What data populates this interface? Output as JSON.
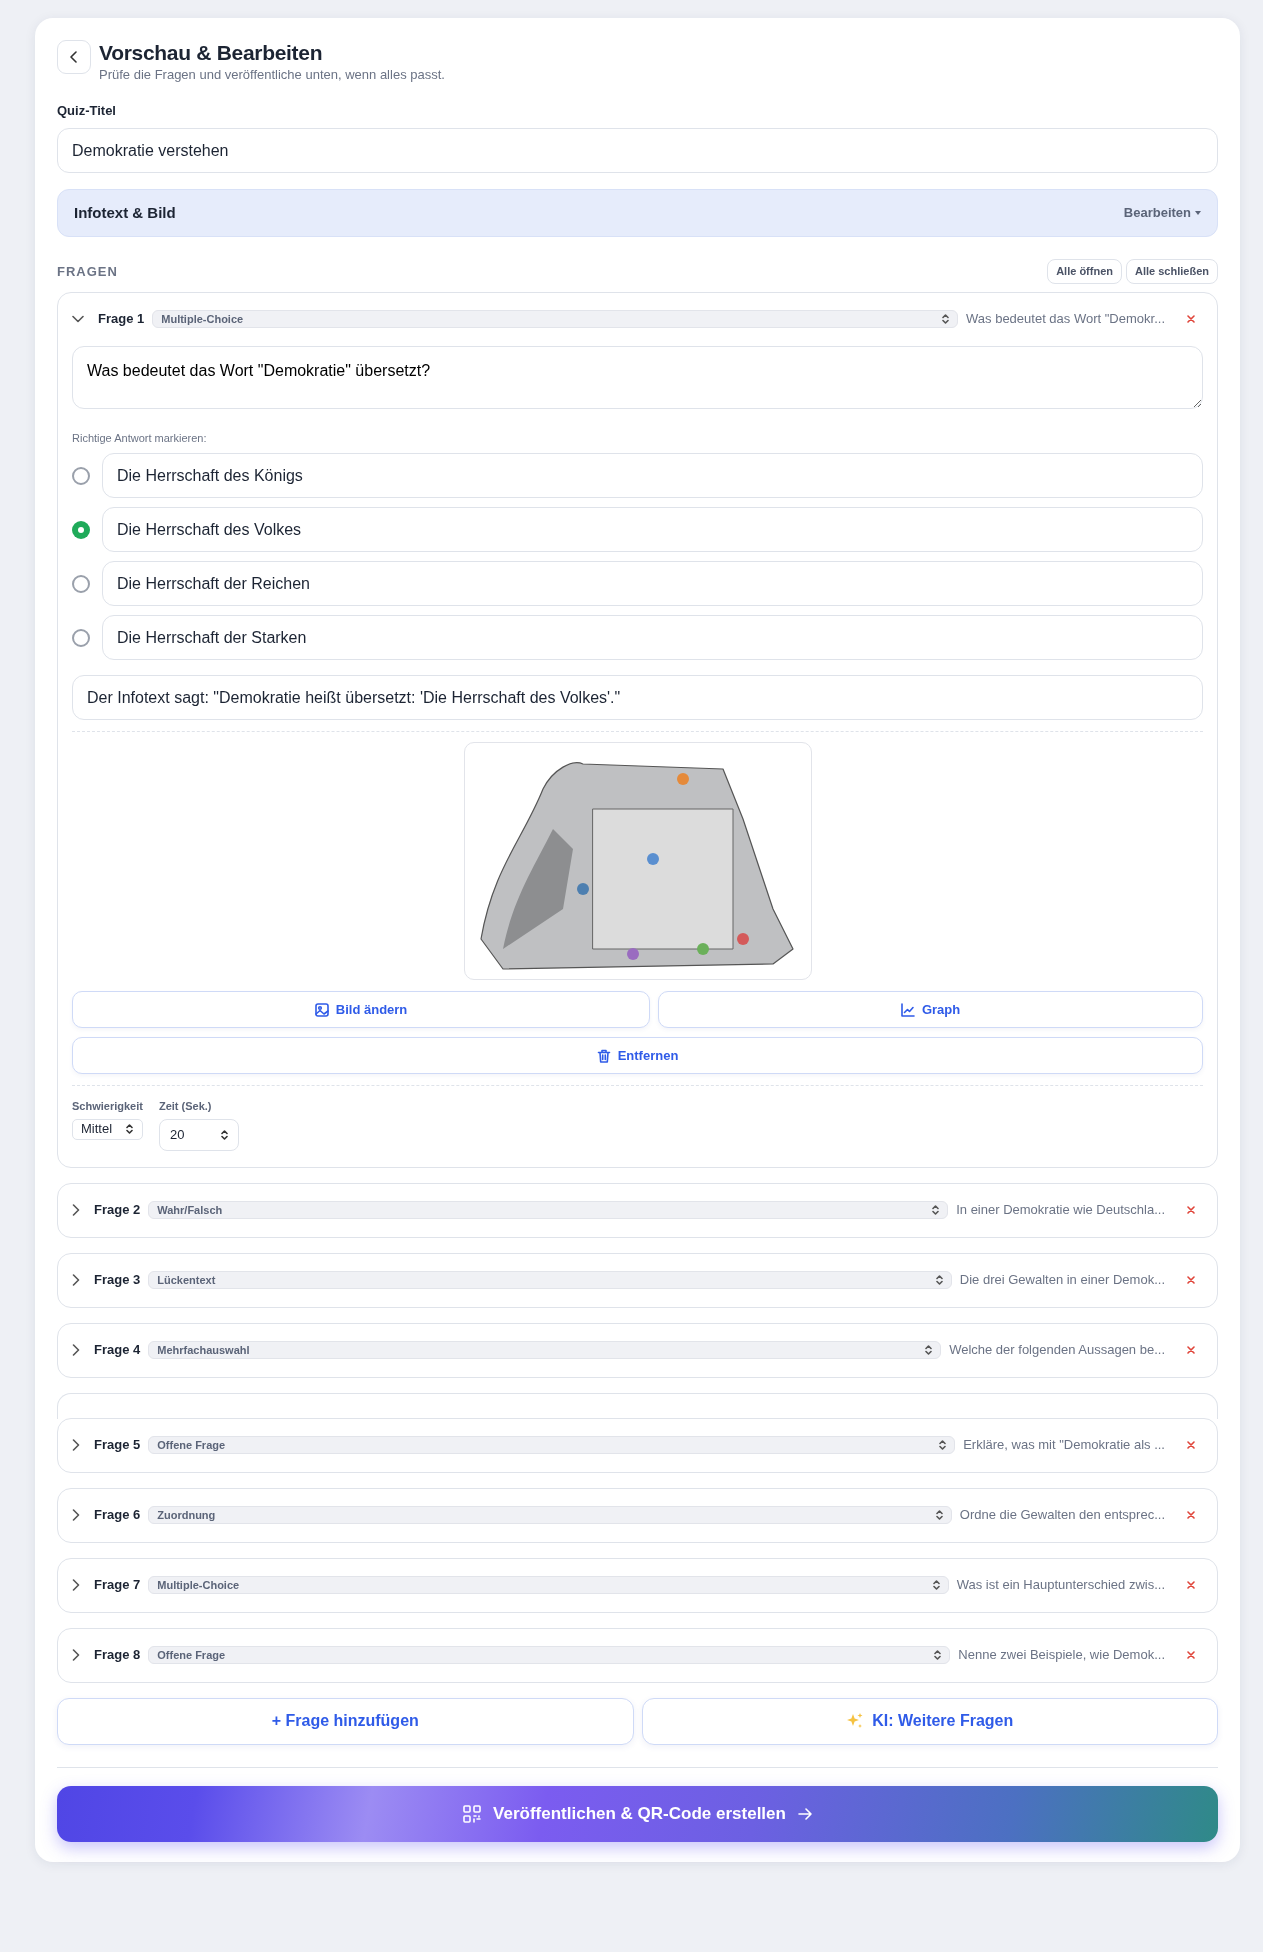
{
  "header": {
    "title": "Vorschau & Bearbeiten",
    "subtitle": "Prüfe die Fragen und veröffentliche unten, wenn alles passt."
  },
  "quiz_title": {
    "label": "Quiz-Titel",
    "value": "Demokratie verstehen"
  },
  "info_section": {
    "title": "Infotext & Bild",
    "action": "Bearbeiten"
  },
  "questions_section": {
    "heading": "FRAGEN",
    "expand_all": "Alle öffnen",
    "collapse_all": "Alle schließen"
  },
  "questions": [
    {
      "label": "Frage 1",
      "type": "Multiple-Choice",
      "preview": "Was bedeutet das Wort \"Demokr...",
      "expanded": true,
      "ghost_behind": false,
      "question_text": "Was bedeutet das Wort \"Demokratie\" übersetzt?",
      "answers_label": "Richtige Antwort markieren:",
      "answers": [
        {
          "text": "Die Herrschaft des Königs",
          "selected": false
        },
        {
          "text": "Die Herrschaft des Volkes",
          "selected": true
        },
        {
          "text": "Die Herrschaft der Reichen",
          "selected": false
        },
        {
          "text": "Die Herrschaft der Starken",
          "selected": false
        }
      ],
      "explanation": "Der Infotext sagt: \"Demokratie heißt übersetzt: 'Die Herrschaft des Volkes'.\"",
      "image_buttons": [
        {
          "label": "Bild ändern",
          "kind": "image"
        },
        {
          "label": "Graph",
          "kind": "graph"
        },
        {
          "label": "Entfernen",
          "kind": "remove"
        }
      ],
      "settings": [
        {
          "label": "Schwierigkeit",
          "value": "Mittel",
          "kind": "select"
        },
        {
          "label": "Zeit (Sek.)",
          "value": "20",
          "kind": "number"
        }
      ]
    },
    {
      "label": "Frage 2",
      "type": "Wahr/Falsch",
      "preview": "In einer Demokratie wie Deutschla...",
      "expanded": false,
      "ghost_behind": false
    },
    {
      "label": "Frage 3",
      "type": "Lückentext",
      "preview": "Die drei Gewalten in einer Demok...",
      "expanded": false,
      "ghost_behind": false
    },
    {
      "label": "Frage 4",
      "type": "Mehrfachauswahl",
      "preview": "Welche der folgenden Aussagen be...",
      "expanded": false,
      "ghost_behind": false
    },
    {
      "label": "Frage 5",
      "type": "Offene Frage",
      "preview": "Erkläre, was mit \"Demokratie als ...",
      "expanded": false,
      "ghost_behind": true
    },
    {
      "label": "Frage 6",
      "type": "Zuordnung",
      "preview": "Ordne die Gewalten den entsprec...",
      "expanded": false,
      "ghost_behind": false
    },
    {
      "label": "Frage 7",
      "type": "Multiple-Choice",
      "preview": "Was ist ein Hauptunterschied zwis...",
      "expanded": false,
      "ghost_behind": false
    },
    {
      "label": "Frage 8",
      "type": "Offene Frage",
      "preview": "Nenne zwei Beispiele, wie Demok...",
      "expanded": false,
      "ghost_behind": false
    }
  ],
  "add_buttons": [
    {
      "label": "+ Frage hinzufügen",
      "kind": "add"
    },
    {
      "label": "KI: Weitere Fragen",
      "kind": "ai"
    }
  ],
  "publish_button": {
    "label": "Veröffentlichen & QR-Code erstellen"
  }
}
